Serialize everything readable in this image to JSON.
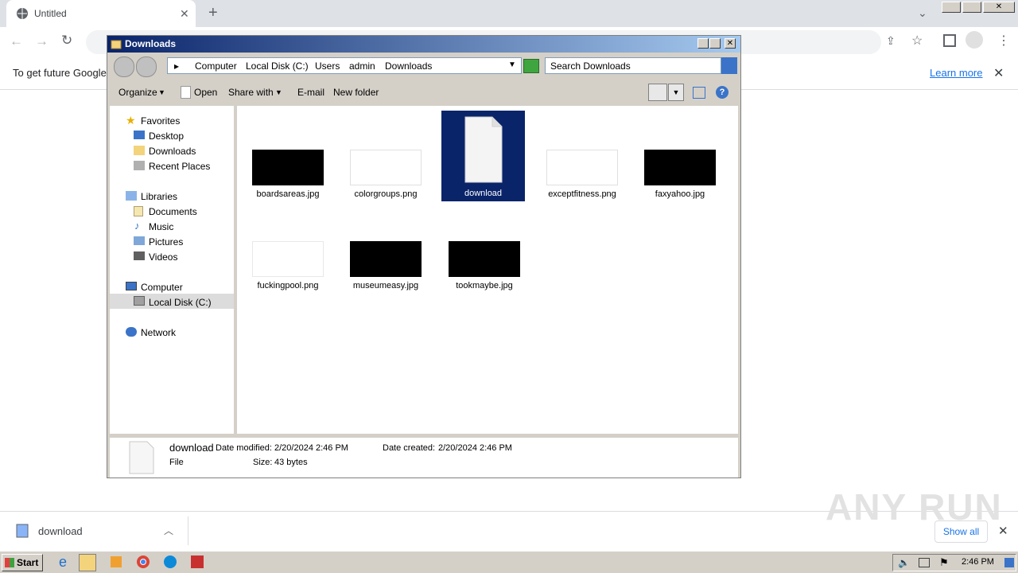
{
  "browser": {
    "tab_title": "Untitled",
    "infobar_text": "To get future Google",
    "infobar_link": "Learn more",
    "download_name": "download",
    "show_all": "Show all"
  },
  "explorer": {
    "title": "Downloads",
    "breadcrumb": [
      "Computer",
      "Local Disk (C:)",
      "Users",
      "admin",
      "Downloads"
    ],
    "search_placeholder": "Search Downloads",
    "commands": {
      "organize": "Organize",
      "open": "Open",
      "share_with": "Share with",
      "email": "E-mail",
      "new_folder": "New folder"
    },
    "nav": {
      "favorites": "Favorites",
      "desktop": "Desktop",
      "downloads": "Downloads",
      "recent": "Recent Places",
      "libraries": "Libraries",
      "documents": "Documents",
      "music": "Music",
      "pictures": "Pictures",
      "videos": "Videos",
      "computer": "Computer",
      "local_disk": "Local Disk (C:)",
      "network": "Network"
    },
    "files": [
      {
        "name": "boardsareas.jpg",
        "thumb": "#000000"
      },
      {
        "name": "colorgroups.png",
        "thumb": "#ffffff"
      },
      {
        "name": "download",
        "thumb": "doc"
      },
      {
        "name": "exceptfitness.png",
        "thumb": "#ffffff"
      },
      {
        "name": "faxyahoo.jpg",
        "thumb": "#000000"
      },
      {
        "name": "fuckingpool.png",
        "thumb": "#ffffff"
      },
      {
        "name": "museumeasy.jpg",
        "thumb": "#000000"
      },
      {
        "name": "tookmaybe.jpg",
        "thumb": "#000000"
      }
    ],
    "details": {
      "name": "download",
      "type": "File",
      "modified_label": "Date modified:",
      "modified": "2/20/2024 2:46 PM",
      "created_label": "Date created:",
      "created": "2/20/2024 2:46 PM",
      "size_label": "Size:",
      "size": "43 bytes"
    }
  },
  "taskbar": {
    "start": "Start",
    "clock": "2:46 PM"
  },
  "watermark": "ANY RUN"
}
